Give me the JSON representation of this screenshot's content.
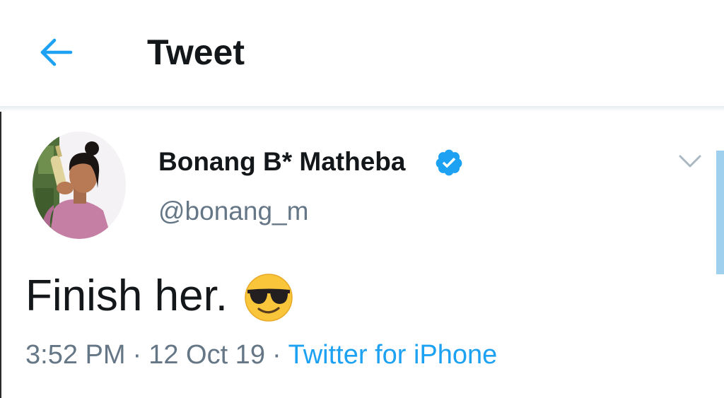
{
  "header": {
    "title": "Tweet",
    "back_icon": "arrow-left-icon"
  },
  "tweet": {
    "author": {
      "display_name": "Bonang B* Matheba",
      "handle": "@bonang_m",
      "verified": true
    },
    "text": "Finish her.",
    "emoji": "smiling-face-with-sunglasses",
    "time": "3:52 PM",
    "date": "12 Oct 19",
    "separator": "·",
    "source": "Twitter for iPhone"
  },
  "colors": {
    "accent": "#1da1f2",
    "text_primary": "#14171a",
    "text_secondary": "#657786",
    "scrollbar": "#9fd1ef"
  }
}
